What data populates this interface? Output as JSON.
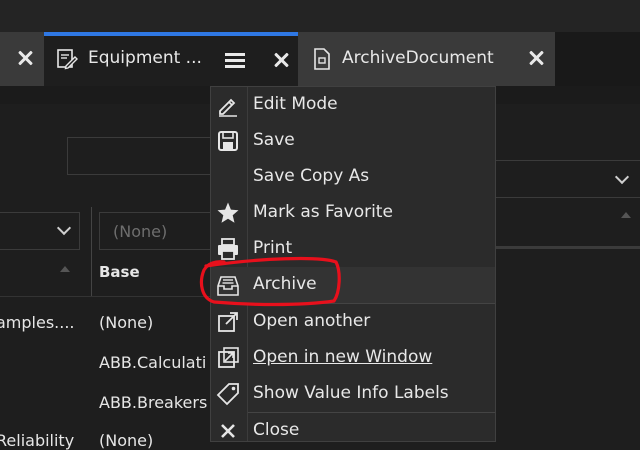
{
  "tabs": {
    "active_title": "Equipment ...",
    "archive_title": "ArchiveDocument"
  },
  "background": {
    "dropdown_value": "(None)",
    "column_header_base": "Base",
    "rows": [
      {
        "left": "amples....",
        "base": "(None)"
      },
      {
        "left": "",
        "base": "ABB.Calculati"
      },
      {
        "left": "",
        "base": "ABB.Breakers"
      },
      {
        "left": "Reliability",
        "base": "(None)"
      }
    ]
  },
  "menu": {
    "items": [
      {
        "label": "Edit Mode",
        "icon": "pencil-icon"
      },
      {
        "label": "Save",
        "icon": "floppy-disk-icon"
      },
      {
        "label": "Save Copy As",
        "icon": ""
      },
      {
        "label": "Mark as Favorite",
        "icon": "star-icon"
      },
      {
        "label": "Print",
        "icon": "printer-icon"
      },
      {
        "label": "Archive",
        "icon": "archive-tray-icon"
      },
      {
        "label": "Open another",
        "icon": "open-external-icon"
      },
      {
        "label": "Open in new Window",
        "icon": "new-window-icon"
      },
      {
        "label": "Show Value Info Labels",
        "icon": "tag-icon"
      },
      {
        "label": "Close",
        "icon": "close-icon"
      }
    ]
  },
  "colors": {
    "accent": "#2f78e4",
    "annotation": "#e8101c",
    "menu_bg": "#2b2b2b"
  }
}
